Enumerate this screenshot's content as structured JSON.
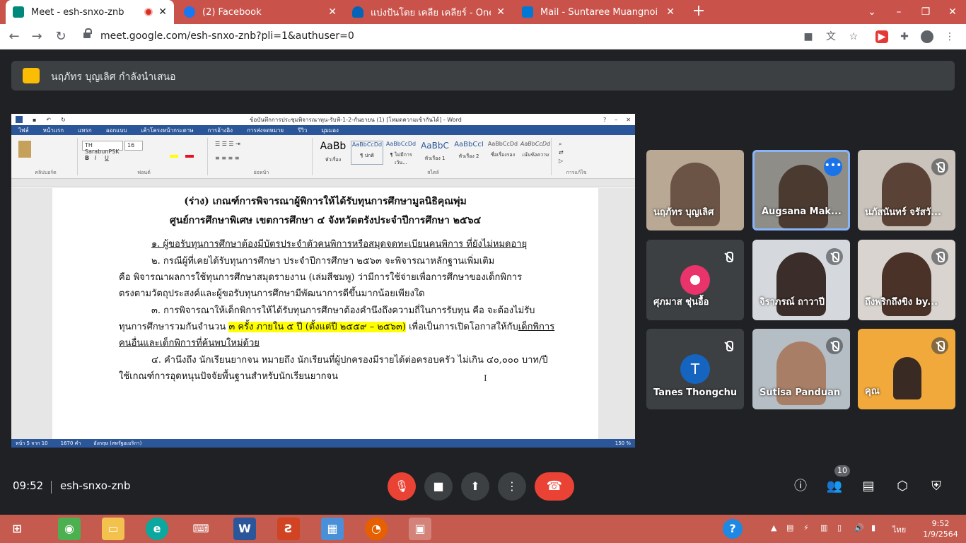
{
  "browser": {
    "tabs": [
      {
        "label": "Meet - esh-snxo-znb",
        "active": true,
        "favicon_color": "#00897b",
        "recording": true
      },
      {
        "label": "(2) Facebook",
        "active": false,
        "favicon_color": "#1877f2"
      },
      {
        "label": "แบ่งปันโดย เคลีย เคลียร์ - OneDrive",
        "active": false,
        "favicon_color": "#0364b8"
      },
      {
        "label": "Mail - Suntaree Muangnoi - Outl",
        "active": false,
        "favicon_color": "#0078d4"
      }
    ],
    "new_tab": "+",
    "address": "meet.google.com/esh-snxo-znb?pli=1&authuser=0"
  },
  "meet": {
    "presenting_text": "นฤภัทร บุญเลิศ กำลังนำเสนอ",
    "meeting_time": "09:52",
    "meeting_code": "esh-snxo-znb",
    "participant_count": "10",
    "accent_end_call": "#ea4335"
  },
  "word": {
    "title": "ข้อบันทึกการประชุมพิจารณาทุน-รับฟ้-1-2-กันยายน (1) [โหมดความเข้ากันได้] - Word",
    "menu": [
      "ไฟล์",
      "หน้าแรก",
      "แทรก",
      "ออกแบบ",
      "เค้าโครงหน้ากระดาษ",
      "การอ้างอิง",
      "การส่งจดหมาย",
      "รีวิว",
      "มุมมอง"
    ],
    "font_name": "TH SarabunPSK",
    "font_size": "16",
    "styles": [
      {
        "sample": "AaBb",
        "name": "หัวเรื่อง"
      },
      {
        "sample": "AaBbCcDd",
        "name": "¶ ปกติ"
      },
      {
        "sample": "AaBbCcDd",
        "name": "¶ ไม่มีการเว้น..."
      },
      {
        "sample": "AaBbC",
        "name": "หัวเรื่อง 1"
      },
      {
        "sample": "AaBbCcI",
        "name": "หัวเรื่อง 2"
      },
      {
        "sample": "AaBbCcDd",
        "name": "ชื่อเรื่องรอง"
      },
      {
        "sample": "AaBbCcDd",
        "name": "เน้นข้อความ"
      }
    ],
    "groups": [
      "คลิปบอร์ด",
      "ฟอนต์",
      "ย่อหน้า",
      "สไตล์",
      "การแก้ไข"
    ],
    "doc": {
      "heading1": "(ร่าง) เกณฑ์การพิจารณาผู้พิการให้ได้รับทุนการศึกษามูลนิธิคุณพุ่ม",
      "heading2": "ศูนย์การศึกษาพิเศษ เขตการศึกษา ๔ จังหวัดตรังประจำปีการศึกษา ๒๕๖๔",
      "p1": "๑. ผู้ขอรับทุนการศึกษาต้องมีบัตรประจำตัวคนพิการหรือสมุดจดทะเบียนคนพิการ  ที่ยังไม่หมดอายุ",
      "p2a": "๒. กรณีผู้ที่เคยได้รับทุนการศึกษา ประจำปีการศึกษา ๒๕๖๓ จะพิจารณาหลักฐานเพิ่มเติม",
      "p2b": "คือ พิจารณาผลการใช้ทุนการศึกษาสมุดรายงาน (เล่มสีชมพู) ว่ามีการใช้จ่ายเพื่อการศึกษาของเด็กพิการ",
      "p2c": "ตรงตามวัตถุประสงค์และผู้ขอรับทุนการศึกษามีพัฒนาการดีขึ้นมากน้อยเพียงใด",
      "p3a": "๓. การพิจารณาให้เด็กพิการให้ได้รับทุนการศึกษาต้องคำนึงถึงความถี่ในการรับทุน คือ จะต้องไม่รับ",
      "p3b_pre": "ทุนการศึกษารวมกันจำนวน ",
      "p3b_hl": "๓ ครั้ง ภายใน ๕ ปี (ตั้งแต่ปี ๒๕๕๙ – ๒๕๖๓)",
      "p3b_mid": " เพื่อเป็นการเปิดโอกาสให้กับ",
      "p3b_u": "เด็กพิการ",
      "p3c": "คนอื่นและเด็กพิการที่ค้นพบใหม่ด้วย",
      "p4a": "๔. คำนึงถึง นักเรียนยากจน หมายถึง นักเรียนที่ผู้ปกครองมีรายได้ต่อครอบครัว ไม่เกิน ๔๐,๐๐๐ บาท/ปี",
      "p4b": "ใช้เกณฑ์การอุดหนุนปัจจัยพื้นฐานสำหรับนักเรียนยากจน"
    },
    "status": {
      "page": "หน้า 5 จาก 10",
      "words": "1670 คำ",
      "language": "อังกฤษ (สหรัฐอเมริกา)",
      "zoom": "150 %"
    }
  },
  "participants": [
    {
      "name": "นฤภัทร บุญเลิศ",
      "muted": false,
      "type": "video",
      "bg": "#b8a894",
      "face": "#6b5446"
    },
    {
      "name": "Augsana Mak...",
      "muted": false,
      "type": "video",
      "bg": "#8e8d88",
      "face": "#4a3a30",
      "speaking": true
    },
    {
      "name": "นภัสนันทร์ จรัสวั...",
      "muted": true,
      "type": "video",
      "bg": "#c9c3bb",
      "face": "#5a4236"
    },
    {
      "name": "ศุภมาส ชุ่นอื้อ",
      "muted": true,
      "type": "avatar",
      "avatar_text": "",
      "avatar_color": "#e8336b"
    },
    {
      "name": "จิราภรณ์ ถาวาปี",
      "muted": true,
      "type": "video",
      "bg": "#d5d8dc",
      "face": "#3b2e2a"
    },
    {
      "name": "ถึงพริกถึงขิง by...",
      "muted": true,
      "type": "video",
      "bg": "#d9d4cf",
      "face": "#4a3228"
    },
    {
      "name": "Tanes Thongchu",
      "muted": true,
      "type": "avatar",
      "avatar_text": "T",
      "avatar_color": "#1565c0"
    },
    {
      "name": "Sutisa Panduan",
      "muted": true,
      "type": "video",
      "bg": "#b5bec4",
      "face": "#a87f66"
    },
    {
      "name": "คุณ",
      "muted": true,
      "type": "video",
      "bg": "#f2a93b",
      "face": "#3a2a24"
    }
  ],
  "taskbar": {
    "time": "9:52",
    "date": "1/9/2564",
    "lang": "ไทย"
  }
}
